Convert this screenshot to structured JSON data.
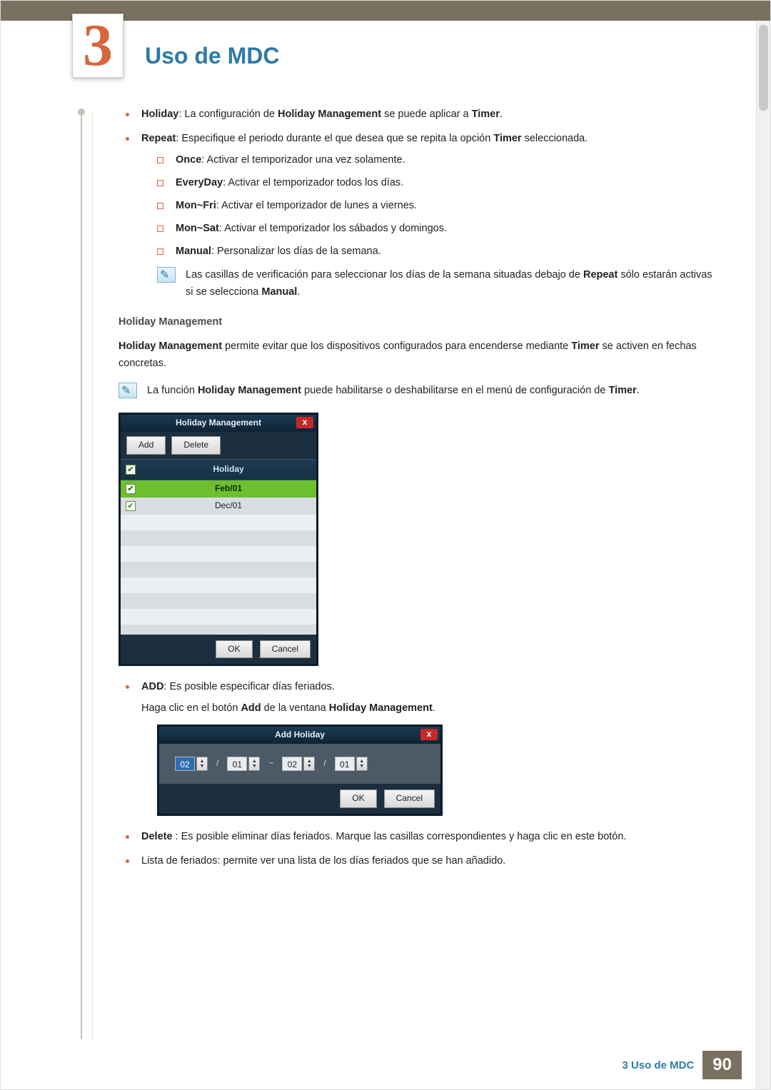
{
  "chapter": {
    "number": "3",
    "title": "Uso de MDC"
  },
  "bullets": {
    "holiday_label": "Holiday",
    "holiday_text": ": La configuración de ",
    "holiday_mgmt": "Holiday Management",
    "holiday_tail": " se puede aplicar a ",
    "timer": "Timer",
    "repeat_label": "Repeat",
    "repeat_text": ": Especifique el periodo durante el que desea que se repita la opción ",
    "repeat_tail": " seleccionada.",
    "once_label": "Once",
    "once_text": ": Activar el temporizador una vez solamente.",
    "everyday_label": "EveryDay",
    "everyday_text": ": Activar el temporizador todos los días.",
    "monfri_label": "Mon~Fri",
    "monfri_text": ": Activar el temporizador de lunes a viernes.",
    "monsat_label": "Mon~Sat",
    "monsat_text": ": Activar el temporizador los sábados y domingos.",
    "manual_label": "Manual",
    "manual_text": ": Personalizar los días de la semana."
  },
  "note1_a": "Las casillas de verificación para seleccionar los días de la semana situadas debajo de ",
  "note1_b": " sólo estarán activas si se selecciona ",
  "h_mgmt_heading": "Holiday Management",
  "h_mgmt_p1_a": "Holiday Management",
  "h_mgmt_p1_b": " permite evitar que los dispositivos configurados para encenderse mediante ",
  "h_mgmt_p1_c": " se activen en fechas concretas.",
  "note2_a": "La función ",
  "note2_b": " puede habilitarse o deshabilitarse en el menú de configuración de ",
  "win1": {
    "title": "Holiday Management",
    "add": "Add",
    "delete": "Delete",
    "col": "Holiday",
    "rows": [
      "Feb/01",
      "Dec/01"
    ],
    "ok": "OK",
    "cancel": "Cancel"
  },
  "add_label": "ADD",
  "add_text": ": Es posible especificar días feriados.",
  "add_sub_a": "Haga clic en el botón ",
  "add_sub_b": " de la ventana ",
  "win2": {
    "title": "Add Holiday",
    "v1": "02",
    "v2": "01",
    "tilde": "~",
    "v3": "02",
    "v4": "01",
    "ok": "OK",
    "cancel": "Cancel",
    "slash": "/"
  },
  "delete_label": "Delete",
  "delete_text": " : Es posible eliminar días feriados. Marque las casillas correspondientes y haga clic en este botón.",
  "list_text": "Lista de feriados: permite ver una lista de los días feriados que se han añadido.",
  "footer": {
    "label": "3 Uso de MDC",
    "page": "90"
  },
  "period": "."
}
